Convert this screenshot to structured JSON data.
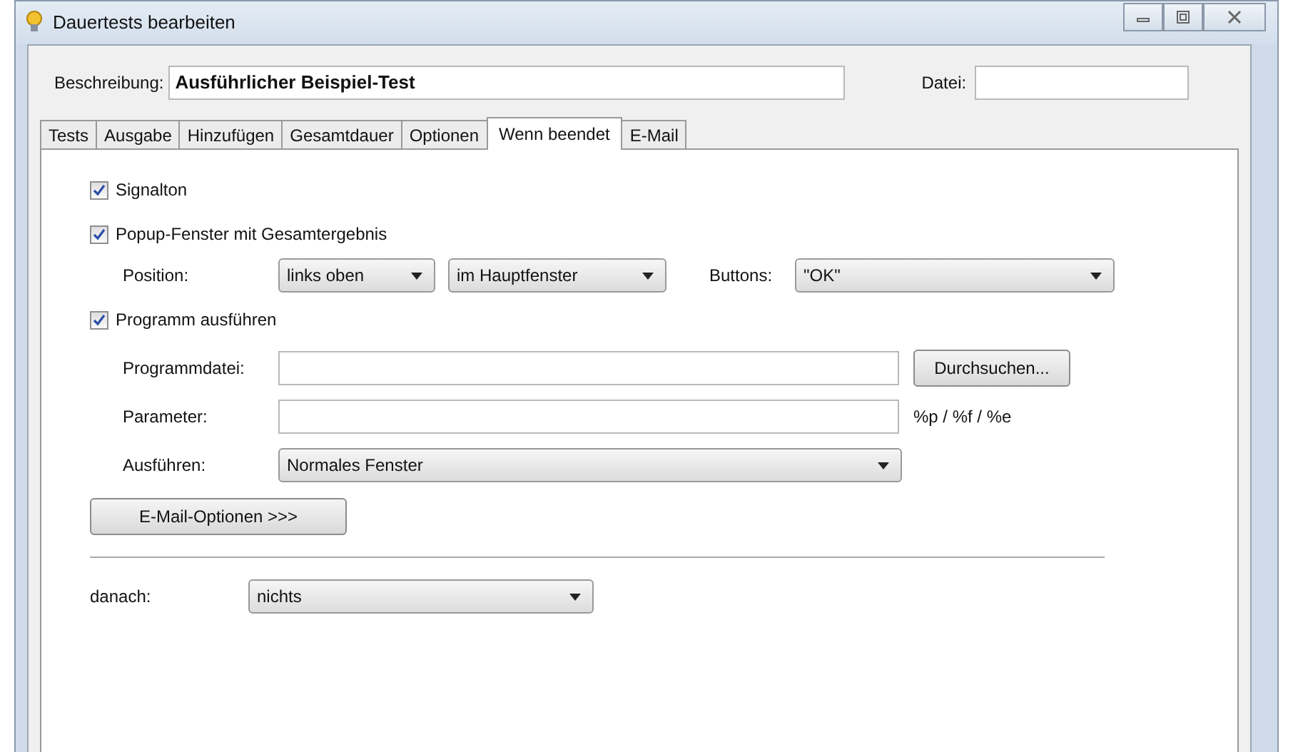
{
  "window": {
    "title": "Dauertests bearbeiten"
  },
  "description": {
    "label": "Beschreibung:",
    "value": "Ausführlicher Beispiel-Test"
  },
  "file": {
    "label": "Datei:"
  },
  "tabs": [
    {
      "label": "Tests",
      "selected": false
    },
    {
      "label": "Ausgabe",
      "selected": false
    },
    {
      "label": "Hinzufügen",
      "selected": false
    },
    {
      "label": "Gesamtdauer",
      "selected": false
    },
    {
      "label": "Optionen",
      "selected": false
    },
    {
      "label": "Wenn beendet",
      "selected": true
    },
    {
      "label": "E-Mail",
      "selected": false
    }
  ],
  "signal": {
    "label": "Signalton",
    "checked": true
  },
  "popup": {
    "label": "Popup-Fenster mit Gesamtergebnis",
    "checked": true,
    "position_label": "Position:",
    "position": "links oben",
    "window": "im Hauptfenster",
    "buttons_label": "Buttons:",
    "buttons": "\"OK\""
  },
  "program": {
    "label": "Programm ausführen",
    "checked": true,
    "file_label": "Programmdatei:",
    "browse": "Durchsuchen...",
    "param_label": "Parameter:",
    "param_hint": "%p / %f / %e",
    "run_label": "Ausführen:",
    "run": "Normales Fenster"
  },
  "email_button": "E-Mail-Optionen >>>",
  "after": {
    "label": "danach:",
    "value": "nichts"
  }
}
